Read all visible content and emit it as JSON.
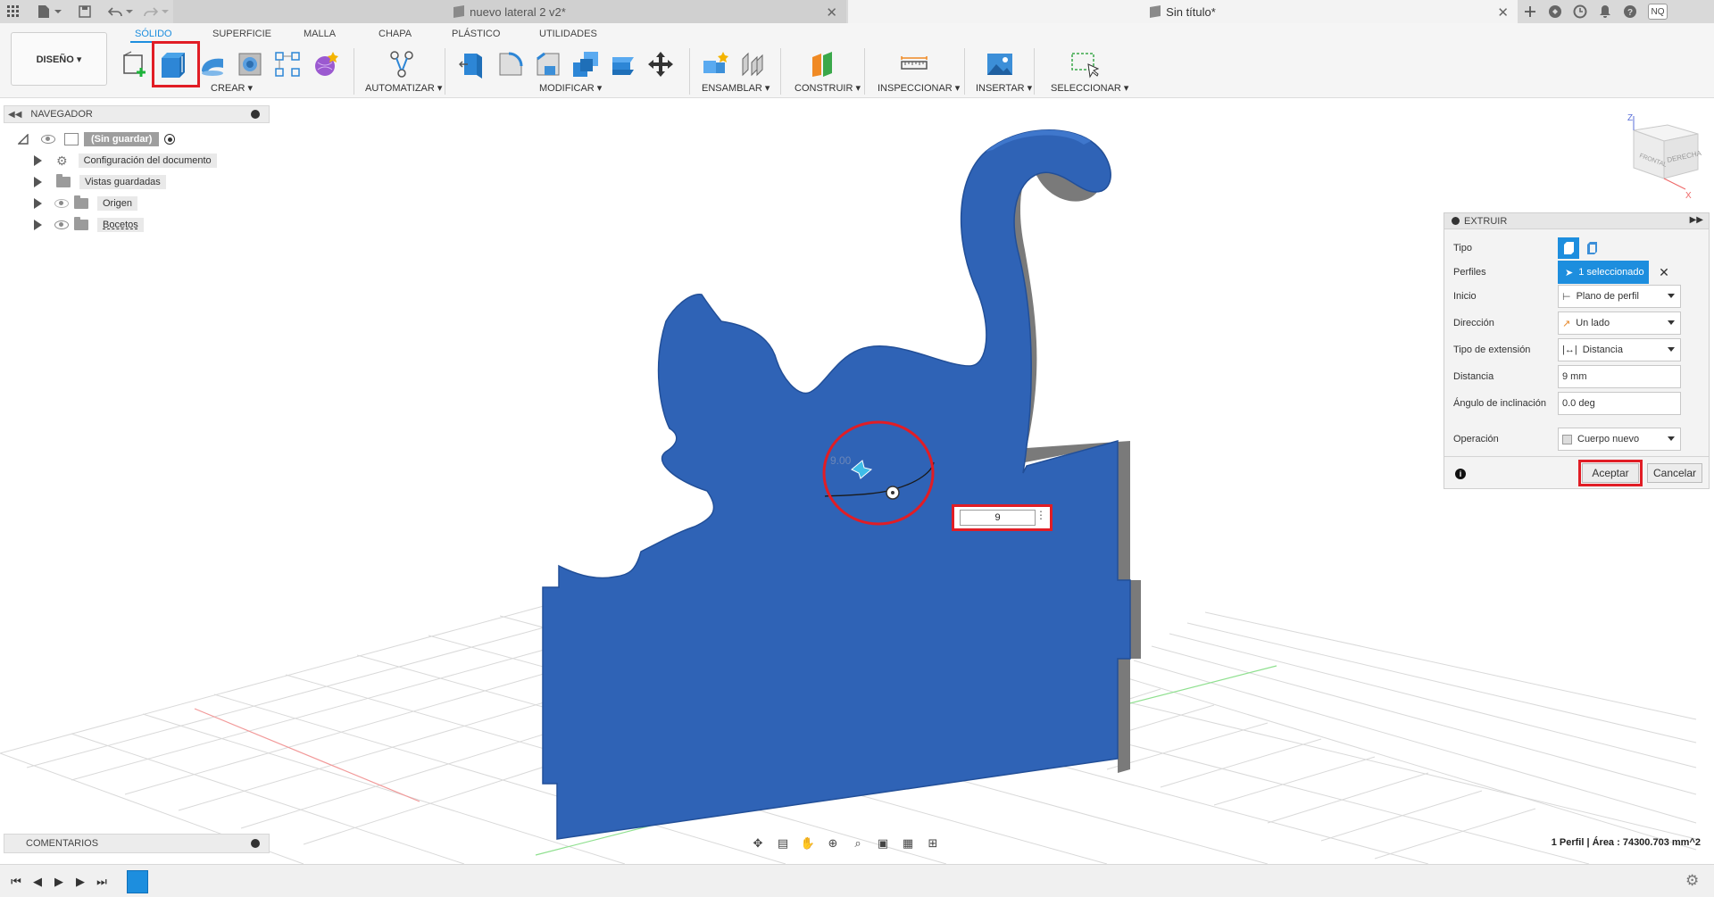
{
  "tabs": {
    "doc1_title": "nuevo lateral 2 v2*",
    "doc2_title": "Sin título*",
    "close_glyph": "✕"
  },
  "user": {
    "initials": "NQ"
  },
  "toolbar": {
    "workspace_button": "DISEÑO ▾",
    "workspace_tabs": [
      "SÓLIDO",
      "SUPERFICIE",
      "MALLA",
      "CHAPA",
      "PLÁSTICO",
      "UTILIDADES"
    ],
    "groups": {
      "create": "CREAR ▾",
      "automate": "AUTOMATIZAR ▾",
      "modify": "MODIFICAR ▾",
      "assemble": "ENSAMBLAR ▾",
      "construct": "CONSTRUIR ▾",
      "inspect": "INSPECCIONAR ▾",
      "insert": "INSERTAR ▾",
      "select": "SELECCIONAR ▾"
    }
  },
  "browser": {
    "title": "NAVEGADOR",
    "root": "(Sin guardar)",
    "items": [
      "Configuración del documento",
      "Vistas guardadas",
      "Origen",
      "Bocetos"
    ]
  },
  "comments": {
    "title": "COMENTARIOS"
  },
  "extrude": {
    "title": "EXTRUIR",
    "rows": {
      "tipo": "Tipo",
      "perfiles": "Perfiles",
      "inicio": "Inicio",
      "direccion": "Dirección",
      "tipo_extension": "Tipo de extensión",
      "distancia": "Distancia",
      "angulo": "Ángulo de inclinación",
      "operacion": "Operación"
    },
    "values": {
      "perfiles": "1 seleccionado",
      "inicio": "Plano de perfil",
      "direccion": "Un lado",
      "tipo_extension": "Distancia",
      "distancia": "9 mm",
      "angulo": "0.0 deg",
      "operacion": "Cuerpo nuevo"
    },
    "accept": "Aceptar",
    "cancel": "Cancelar"
  },
  "viewport": {
    "distance_input": "9",
    "manipulator_label": "9.00"
  },
  "viewcube": {
    "front": "FRONTAL",
    "right": "DERECHA",
    "axis_z": "Z",
    "axis_x": "X"
  },
  "status": {
    "text": "1 Perfil | Área : 74300.703 mm^2"
  },
  "colors": {
    "accent": "#1d8ede",
    "body": "#2f63b6",
    "highlight": "#e11d25"
  }
}
